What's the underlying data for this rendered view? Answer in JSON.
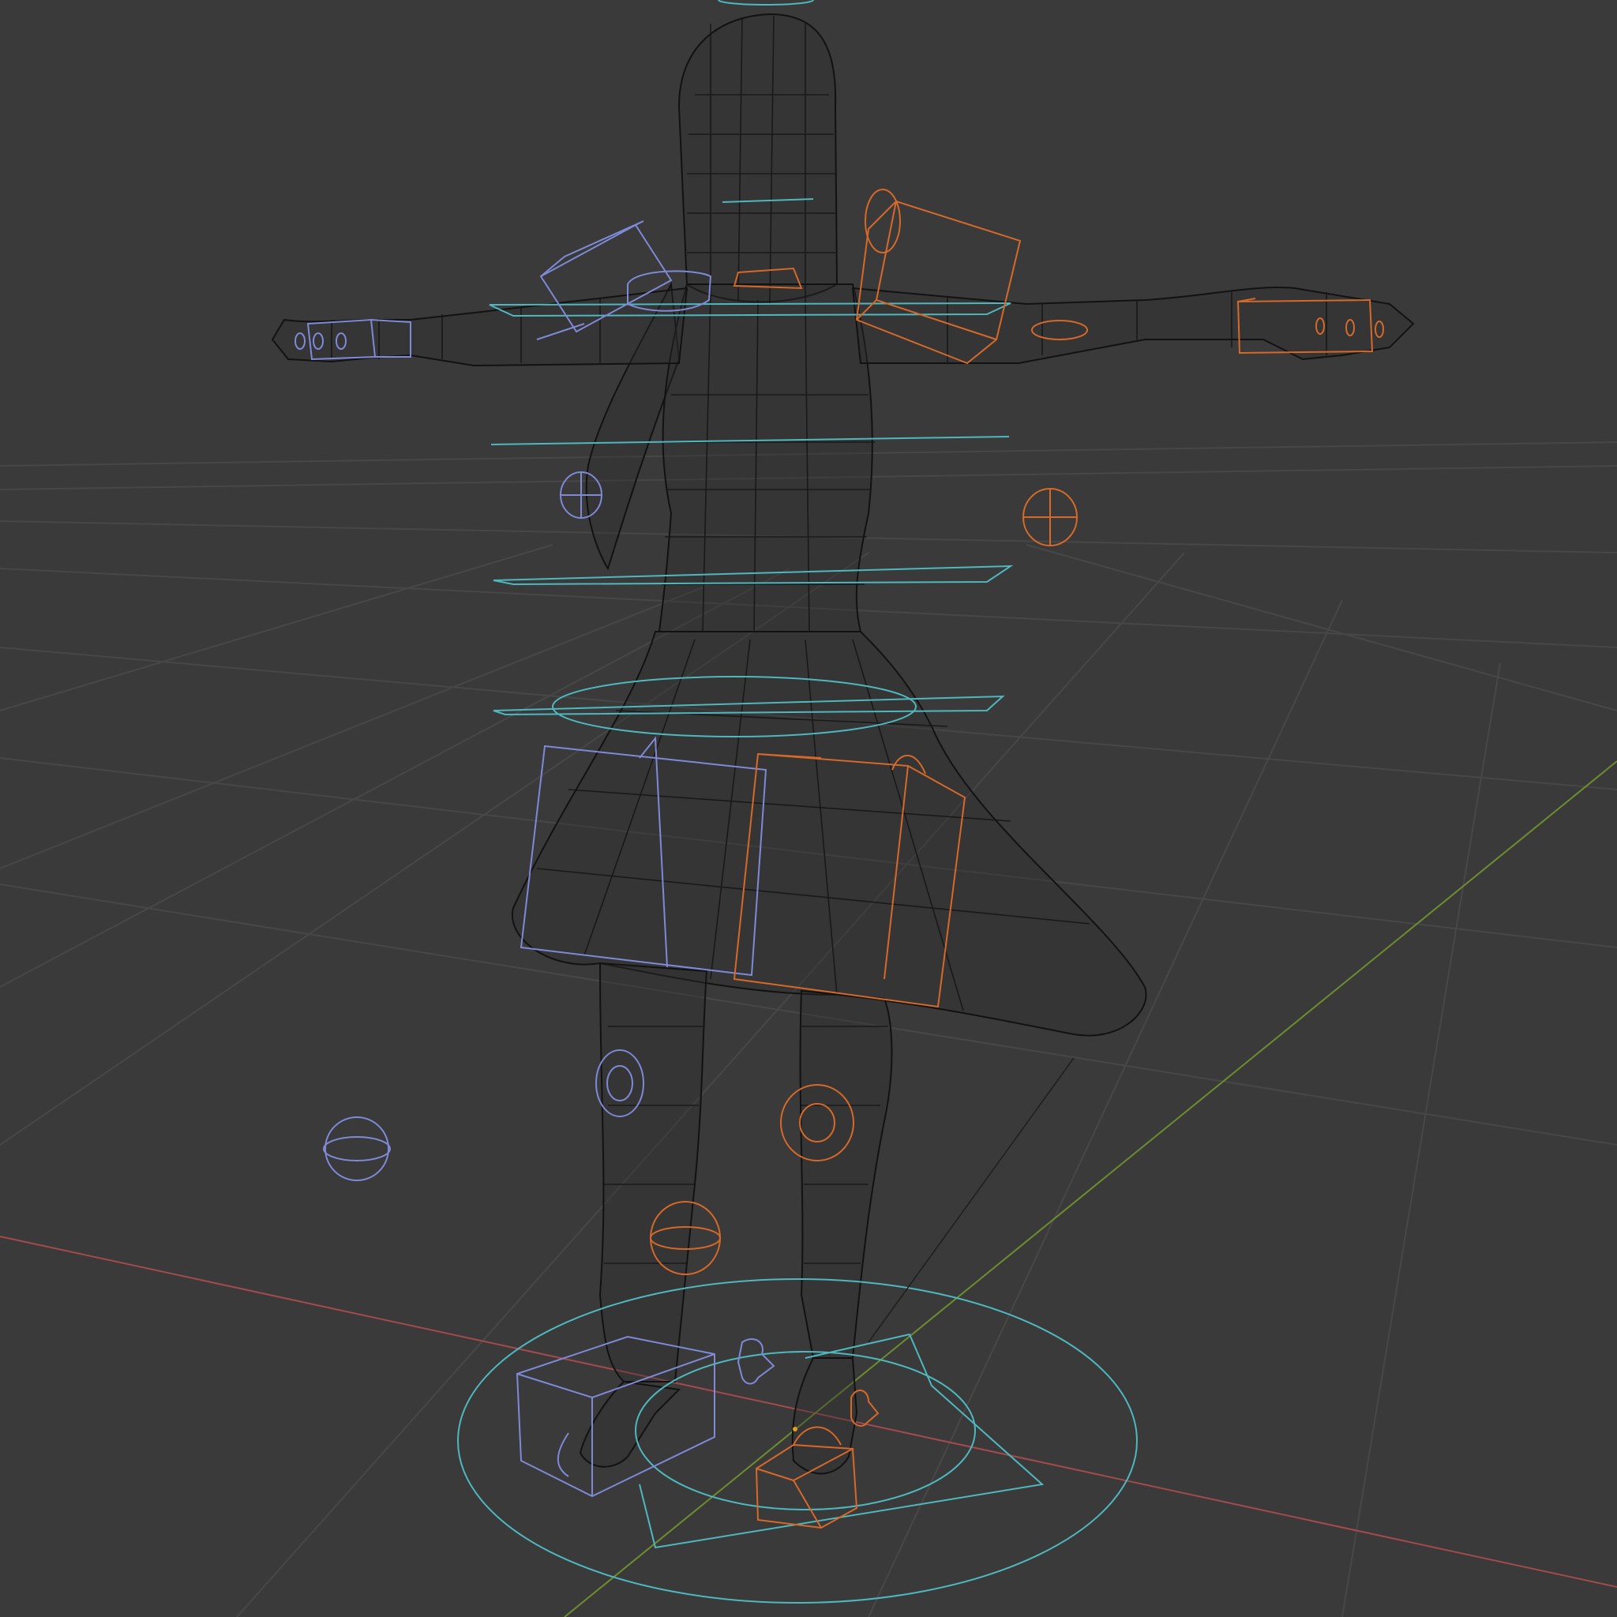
{
  "viewport": {
    "background_color": "#3a3a3a",
    "shading_mode": "wireframe",
    "view": "perspective"
  },
  "scene": {
    "object": "character-mesh",
    "pose": "T-pose",
    "has_armature_controls": true
  },
  "colors": {
    "grid": "#4a4a4a",
    "x_axis": "#a34a4f",
    "y_axis": "#6f8c2e",
    "mesh_wire": "#121212",
    "control_cyan": "#4fb7be",
    "control_left_blue": "#7f89d6",
    "control_right_orange": "#d5692a"
  },
  "icons": {
    "floor_grid": "grid-icon",
    "root_control": "circle-control-icon",
    "ik_control": "box-control-icon",
    "pole_target": "sphere-control-icon"
  }
}
